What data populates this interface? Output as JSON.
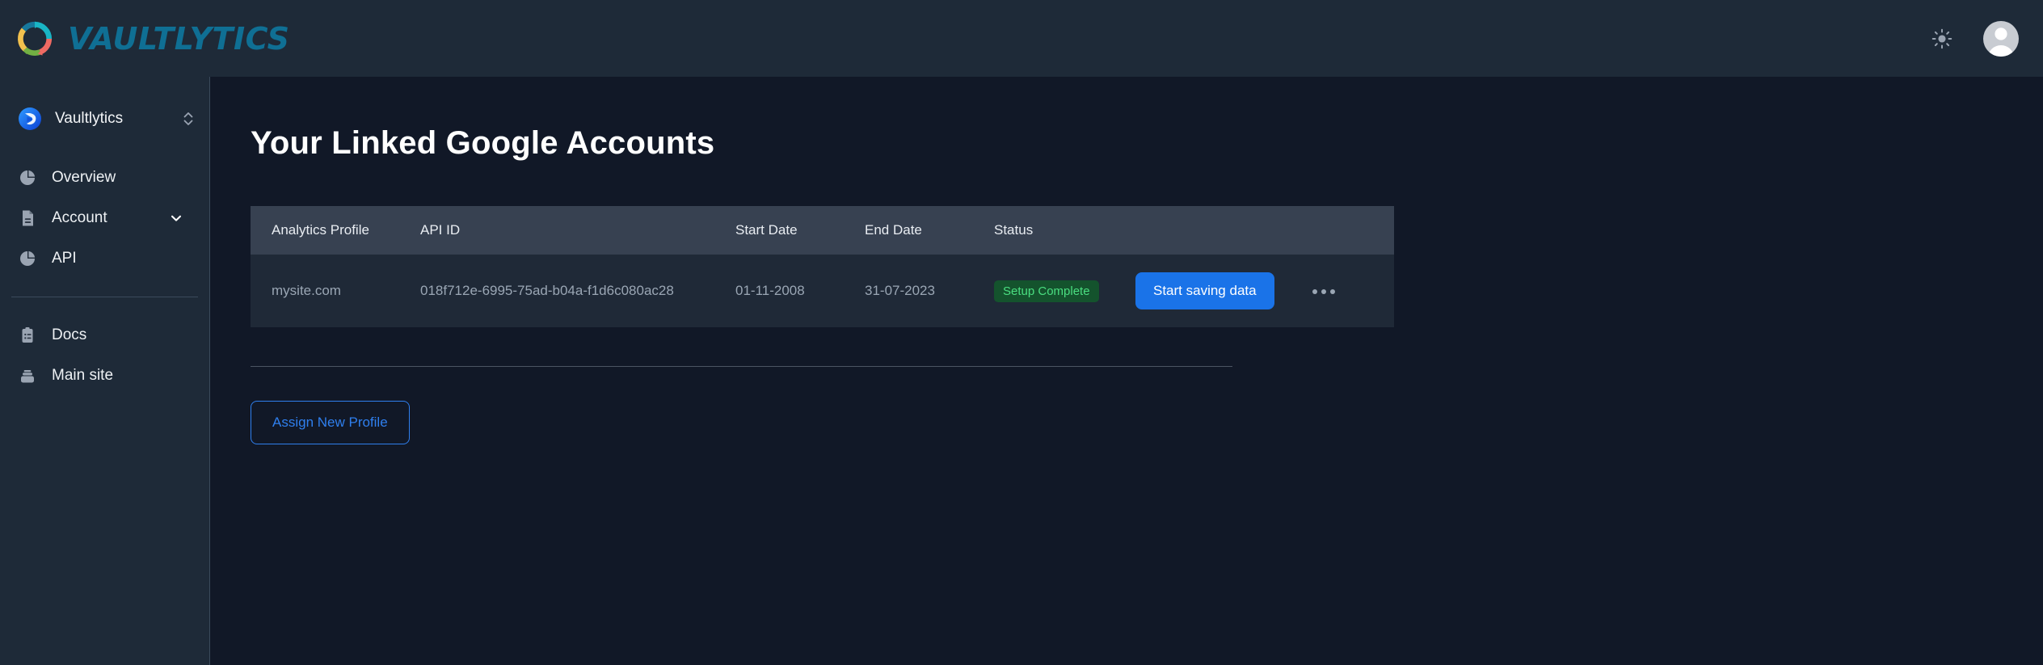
{
  "topbar": {
    "brand_name": "VAULTLYTICS",
    "brand_color": "#0f6f94",
    "theme_toggle_label": "sun-icon",
    "avatar_label": "user-avatar"
  },
  "sidebar": {
    "workspace": {
      "label": "Vaultlytics",
      "switcher_icon": "chevron-up-down-icon"
    },
    "items": [
      {
        "label": "Overview",
        "icon": "pie-chart-icon",
        "has_chevron": false
      },
      {
        "label": "Account",
        "icon": "document-icon",
        "has_chevron": true
      },
      {
        "label": "API",
        "icon": "pie-chart-icon",
        "has_chevron": false
      }
    ],
    "footer_items": [
      {
        "label": "Docs",
        "icon": "clipboard-list-icon"
      },
      {
        "label": "Main site",
        "icon": "layers-icon"
      }
    ]
  },
  "main": {
    "page_title": "Your Linked Google Accounts",
    "table": {
      "columns": [
        "Analytics Profile",
        "API ID",
        "Start Date",
        "End Date",
        "Status",
        "",
        ""
      ],
      "rows": [
        {
          "profile": "mysite.com",
          "api_id": "018f712e-6995-75ad-b04a-f1d6c080ac28",
          "start_date": "01-11-2008",
          "end_date": "31-07-2023",
          "status": "Setup Complete",
          "status_color": "#4ade80",
          "action_label": "Start saving data",
          "action_color": "#1a73e8",
          "more_label": "more-options"
        }
      ]
    },
    "assign_button_label": "Assign New Profile",
    "assign_button_color": "#2f7fee"
  }
}
